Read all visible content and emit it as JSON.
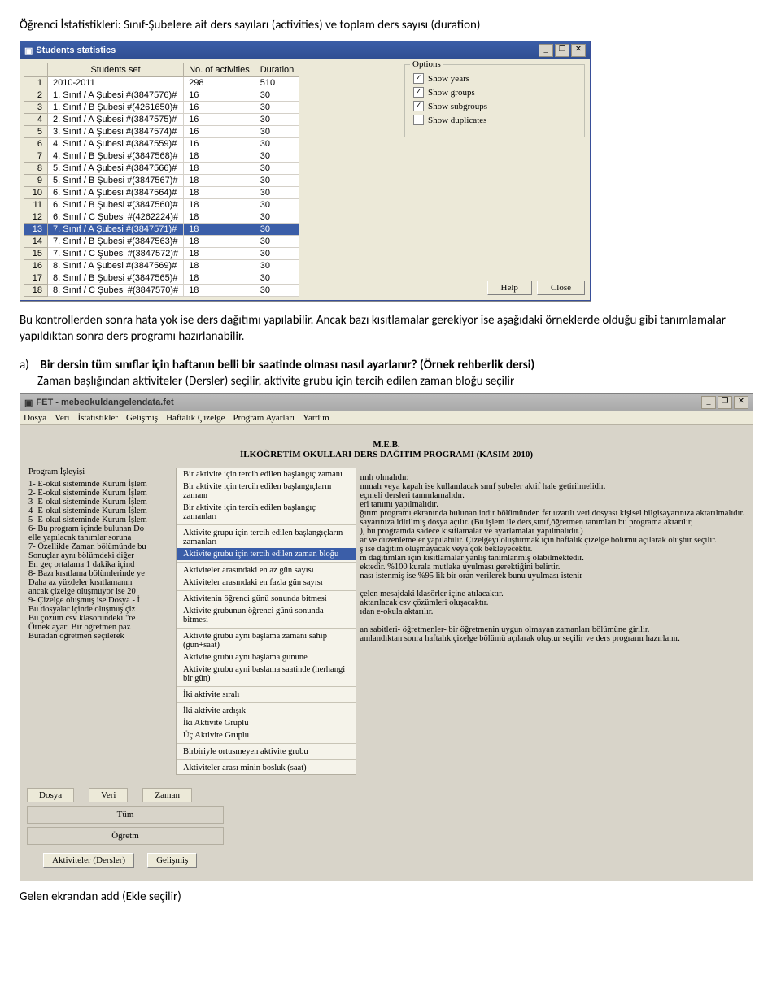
{
  "doc": {
    "title": "Öğrenci İstatistikleri:  Sınıf-Şubelere ait ders sayıları (activities) ve toplam ders sayısı (duration)",
    "para": "Bu kontrollerden sonra hata yok ise ders dağıtımı yapılabilir. Ancak bazı kısıtlamalar gerekiyor ise aşağıdaki örneklerde olduğu gibi tanımlamalar yapıldıktan sonra ders programı hazırlanabilir.",
    "list_a_label": "a)",
    "list_a_bold": "Bir dersin tüm sınıflar için haftanın belli bir saatinde olması nasıl ayarlanır? (Örnek rehberlik dersi)",
    "list_a_rest": "Zaman başlığından aktiviteler (Dersler) seçilir, aktivite grubu için tercih edilen zaman bloğu seçilir",
    "bottom": "Gelen ekrandan add (Ekle seçilir)"
  },
  "stats": {
    "title": "Students statistics",
    "icon": "▣",
    "headers": [
      "",
      "Students set",
      "No. of activities",
      "Duration"
    ],
    "rows": [
      [
        "1",
        "2010-2011",
        "298",
        "510"
      ],
      [
        "2",
        "1. Sınıf / A Şubesi #(3847576)#",
        "16",
        "30"
      ],
      [
        "3",
        "1. Sınıf / B Şubesi #(4261650)#",
        "16",
        "30"
      ],
      [
        "4",
        "2. Sınıf / A Şubesi #(3847575)#",
        "16",
        "30"
      ],
      [
        "5",
        "3. Sınıf / A Şubesi #(3847574)#",
        "16",
        "30"
      ],
      [
        "6",
        "4. Sınıf / A Şubesi #(3847559)#",
        "16",
        "30"
      ],
      [
        "7",
        "4. Sınıf / B Şubesi #(3847568)#",
        "18",
        "30"
      ],
      [
        "8",
        "5. Sınıf / A Şubesi #(3847566)#",
        "18",
        "30"
      ],
      [
        "9",
        "5. Sınıf / B Şubesi #(3847567)#",
        "18",
        "30"
      ],
      [
        "10",
        "6. Sınıf / A Şubesi #(3847564)#",
        "18",
        "30"
      ],
      [
        "11",
        "6. Sınıf / B Şubesi #(3847560)#",
        "18",
        "30"
      ],
      [
        "12",
        "6. Sınıf / C Şubesi #(4262224)#",
        "18",
        "30"
      ],
      [
        "13",
        "7. Sınıf / A Şubesi #(3847571)#",
        "18",
        "30"
      ],
      [
        "14",
        "7. Sınıf / B Şubesi #(3847563)#",
        "18",
        "30"
      ],
      [
        "15",
        "7. Sınıf / C Şubesi #(3847572)#",
        "18",
        "30"
      ],
      [
        "16",
        "8. Sınıf / A Şubesi #(3847569)#",
        "18",
        "30"
      ],
      [
        "17",
        "8. Sınıf / B Şubesi #(3847565)#",
        "18",
        "30"
      ],
      [
        "18",
        "8. Sınıf / C Şubesi #(3847570)#",
        "18",
        "30"
      ]
    ],
    "selected_row": 12,
    "options": {
      "legend": "Options",
      "cb": [
        {
          "label": "Show years",
          "checked": true
        },
        {
          "label": "Show groups",
          "checked": true
        },
        {
          "label": "Show subgroups",
          "checked": true
        },
        {
          "label": "Show duplicates",
          "checked": false
        }
      ]
    },
    "help": "Help",
    "close": "Close"
  },
  "fet": {
    "title": "FET - mebeokuldangelendata.fet",
    "icon": "▣",
    "menus": [
      "Dosya",
      "Veri",
      "İstatistikler",
      "Gelişmiş",
      "Haftalık Çizelge",
      "Program Ayarları",
      "Yardım"
    ],
    "center1": "M.E.B.",
    "center2": "İLKÖĞRETİM OKULLARI DERS DAĞITIM PROGRAMI (KASIM 2010)",
    "left": {
      "hdr": "Program İşleyişi",
      "lines": [
        "1- E-okul sisteminde Kurum İşlem",
        "2- E-okul sisteminde Kurum İşlem",
        "3- E-okul sisteminde Kurum İşlem",
        "4- E-okul sisteminde Kurum İşlem",
        "5- E-okul sisteminde Kurum İşlem",
        "6- Bu program içinde bulunan Do",
        "    elle yapılacak tanımlar soruna",
        "7- Özellikle Zaman bölümünde bu",
        "    Sonuçlar aynı bölümdeki diğer",
        "    En geç ortalama 1 dakika içind",
        "8- Bazı kısıtlama bölümlerinde ye",
        "    Daha az yüzdeler kısıtlamanın",
        "    ancak çizelge oluşmuyor ise 20",
        "9- Çizelge oluşmuş ise Dosya - İ",
        "    Bu dosyalar içinde oluşmuş çiz",
        "    Bu çözüm csv klasöründeki \"re",
        "",
        "Örnek ayar: Bir öğretmen paz",
        "   Buradan öğretmen seçilerek"
      ]
    },
    "dropdown": [
      {
        "text": "Bir aktivite için tercih edilen başlangıç zamanı"
      },
      {
        "text": "Bir aktivite için tercih edilen başlangıçların zamanı"
      },
      {
        "text": "Bir aktivite için tercih edilen başlangıç zamanları"
      },
      {
        "sep": true
      },
      {
        "text": "Aktivite grupu için tercih edilen başlangıçların zamanları"
      },
      {
        "text": "Aktivite grubu için tercih edilen zaman bloğu",
        "selected": true
      },
      {
        "sep": true
      },
      {
        "text": "Aktiviteler arasındaki en az gün sayısı"
      },
      {
        "text": "Aktiviteler arasındaki en fazla gün sayısı"
      },
      {
        "sep": true
      },
      {
        "text": "Aktivitenin öğrenci günü sonunda bitmesi"
      },
      {
        "text": "Aktivite grubunun öğrenci günü sonunda bitmesi"
      },
      {
        "sep": true
      },
      {
        "text": "Aktivite grubu aynı başlama zamanı sahip (gun+saat)"
      },
      {
        "text": "Aktivite grubu aynı başlama gunune"
      },
      {
        "text": "Aktivite grubu ayni baslama saatinde  (herhangi bir gün)"
      },
      {
        "sep": true
      },
      {
        "text": "İki aktivite sıralı"
      },
      {
        "sep": true
      },
      {
        "text": "İki aktivite ardışık"
      },
      {
        "text": "İki Aktivite Gruplu"
      },
      {
        "text": "Üç Aktivite Gruplu"
      },
      {
        "sep": true
      },
      {
        "text": "Birbiriyle ortusmeyen aktivite grubu"
      },
      {
        "sep": true
      },
      {
        "text": "Aktiviteler arası minin bosluk  (saat)"
      }
    ],
    "right": [
      "",
      "ımlı olmalıdır.",
      "ınmalı veya kapalı ise kullanılacak sınıf şubeler aktif hale getirilmelidir.",
      "eçmeli dersleri tanımlamalıdır.",
      "eri tanımı yapılmalıdır.",
      "ğıtım programı ekranında bulunan indir bölümünden fet uzatılı veri dosyası kişisel bilgisayarınıza aktarılmalıdır.",
      "sayarınıza idirilmiş dosya açılır. (Bu işlem ile ders,sınıf,öğretmen tanımları bu programa aktarılır,",
      "), bu programda sadece kısıtlamalar ve ayarlamalar yapılmalıdır.)",
      "ar ve düzenlemeler yapılabilir. Çizelgeyi oluşturmak için haftalık çizelge bölümü açılarak oluştur seçilir.",
      "ş ise dağıtım oluşmayacak veya çok bekleyecektir.",
      "m dağıtımları için kısıtlamalar yanlış tanımlanmış olabilmektedir.",
      "ektedir. %100 kurala mutlaka uyulması gerektiğini belirtir.",
      "nası istenmiş ise %95 lik bir oran verilerek bunu uyulması istenir",
      "",
      "çelen mesajdaki klasörler içine atılacaktır.",
      "aktarılacak csv çözümleri oluşacaktır.",
      "ıdan e-okula aktarılır.",
      "",
      "an sabitleri- öğretmenler- bir öğretmenin uygun olmayan zamanları bölümüne girilir.",
      "amlandıktan sonra haftalık çizelge bölümü açılarak oluştur seçilir ve ders programı hazırlanır."
    ],
    "lower_menu": [
      "Dosya",
      "Veri",
      "Zaman"
    ],
    "mini_boxes": [
      "Tüm",
      "Öğretm"
    ],
    "act_btns": [
      "Aktiviteler (Dersler)",
      "Gelişmiş"
    ]
  }
}
